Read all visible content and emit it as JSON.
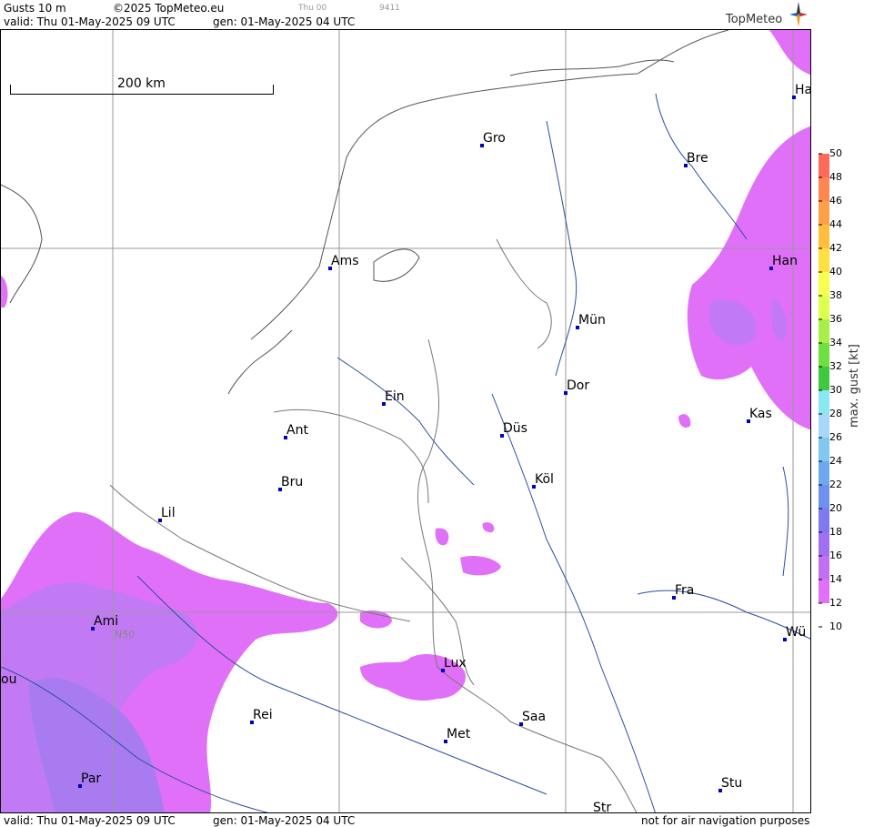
{
  "header": {
    "product": "Gusts 10 m",
    "copyright": "©2025 TopMeteo.eu",
    "small_day": "Thu 00",
    "small_code": "9411",
    "valid_label": "valid:  Thu  01-May-2025  09 UTC",
    "gen_label": "gen: 01-May-2025 04 UTC",
    "logo": "TopMeteo"
  },
  "footer": {
    "valid_label": "valid:  Thu  01-May-2025  09 UTC",
    "gen_label": "gen: 01-May-2025 04 UTC",
    "disclaimer": "not for air navigation purposes"
  },
  "map": {
    "scale_label": "200 km",
    "gridline_label": "N50",
    "cities": [
      "Ha",
      "Gro",
      "Bre",
      "Ams",
      "Han",
      "Mün",
      "Dor",
      "Ein",
      "Kas",
      "Düs",
      "Ant",
      "Köl",
      "Bru",
      "Lil",
      "Fra",
      "Ami",
      "Wü",
      "Lux",
      "ou",
      "Rei",
      "Saa",
      "Met",
      "Par",
      "Stu",
      "Str"
    ]
  },
  "legend": {
    "title": "max. gust [kt]",
    "ticks": [
      "50",
      "48",
      "46",
      "44",
      "42",
      "40",
      "38",
      "36",
      "34",
      "32",
      "30",
      "28",
      "26",
      "24",
      "22",
      "20",
      "18",
      "16",
      "14",
      "12",
      "10"
    ],
    "colors": [
      "#ff6a5a",
      "#ff8650",
      "#ffa048",
      "#ffbf3c",
      "#ffe040",
      "#f8ff50",
      "#dcff50",
      "#a8f048",
      "#70e040",
      "#40c840",
      "#8ae8f0",
      "#a8d8f8",
      "#80c8f0",
      "#70a8f0",
      "#7090f0",
      "#8078f0",
      "#a070f0",
      "#c070f0",
      "#e070f8"
    ]
  }
}
